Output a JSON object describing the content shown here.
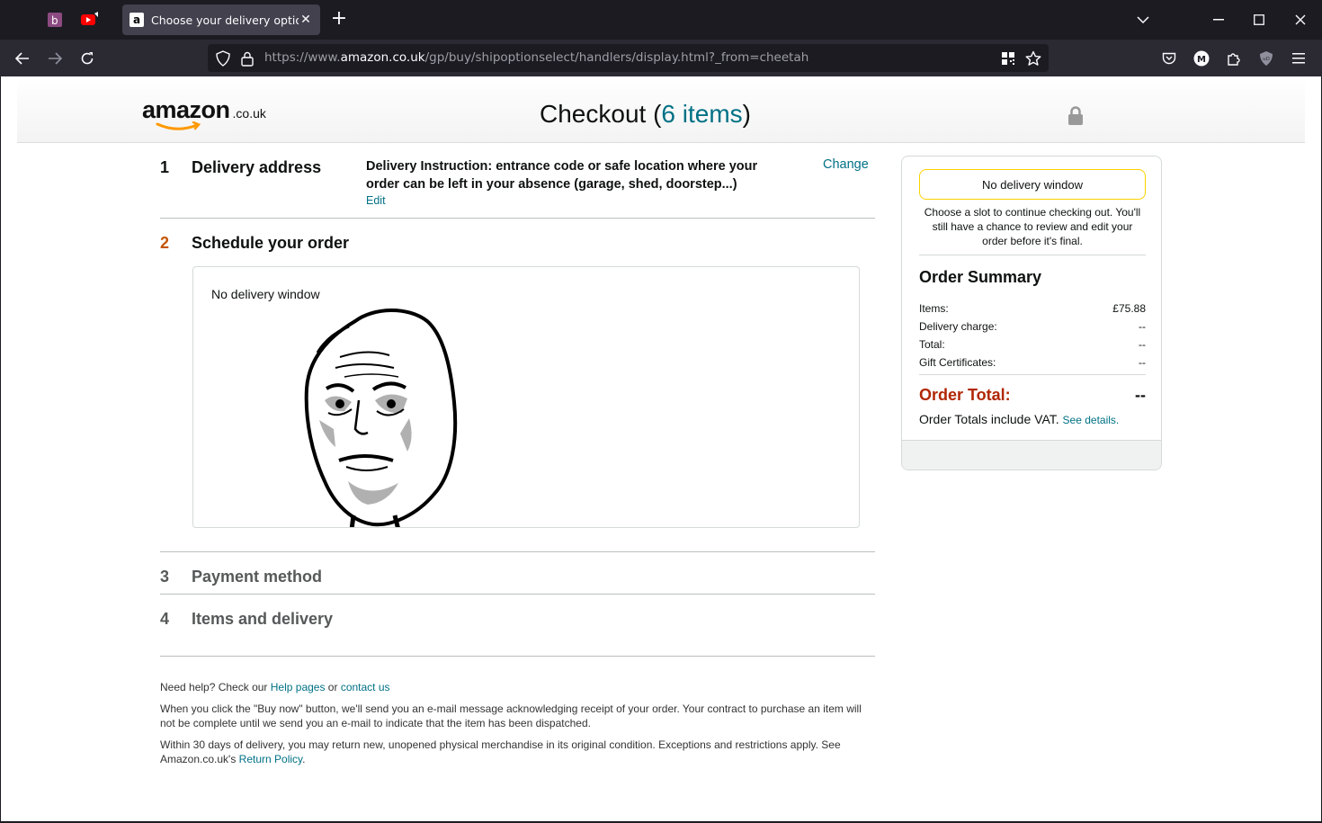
{
  "browser": {
    "tab_title": "Choose your delivery options",
    "tab_favicon": "a",
    "url_protocol": "https://www.",
    "url_host": "amazon.co.uk",
    "url_path": "/gp/buy/shipoptionselect/handlers/display.html?_from=cheetah",
    "profile_initial": "M",
    "extension_badge": "uD"
  },
  "header": {
    "logo_word": "amazon",
    "logo_tld": ".co.uk",
    "checkout_label": "Checkout",
    "items_open": "(",
    "items_count": "6 items",
    "items_close": ")"
  },
  "steps": [
    {
      "number": "1",
      "title": "Delivery address"
    },
    {
      "number": "2",
      "title": "Schedule your order"
    },
    {
      "number": "3",
      "title": "Payment method"
    },
    {
      "number": "4",
      "title": "Items and delivery"
    }
  ],
  "delivery": {
    "instruction": "Delivery Instruction: entrance code or safe location where your order can be left in your absence (garage, shed, doorstep...)",
    "edit_label": "Edit",
    "change_label": "Change"
  },
  "schedule": {
    "no_window_text": "No delivery window"
  },
  "footer": {
    "help_prefix": "Need help? Check our ",
    "help_pages": "Help pages",
    "help_or": " or ",
    "contact_us": "contact us",
    "buy_now_text": "When you click the \"Buy now\" button, we'll send you an e-mail message acknowledging receipt of your order. Your contract to purchase an item will not be complete until we send you an e-mail to indicate that the item has been dispatched.",
    "return_text": "Within 30 days of delivery, you may return new, unopened physical merchandise in its original condition. Exceptions and restrictions apply. See Amazon.co.uk's ",
    "return_policy": "Return Policy",
    "return_end": "."
  },
  "sidebar": {
    "delivery_window_button": "No delivery window",
    "note": "Choose a slot to continue checking out. You'll still have a chance to review and edit your order before it's final.",
    "summary_title": "Order Summary",
    "rows": [
      {
        "label": "Items:",
        "value": "£75.88"
      },
      {
        "label": "Delivery charge:",
        "value": "--"
      },
      {
        "label": "Total:",
        "value": "--"
      },
      {
        "label": "Gift Certificates:",
        "value": "--"
      }
    ],
    "order_total_label": "Order Total:",
    "order_total_value": "--",
    "vat_text": "Order Totals include VAT.",
    "see_details": "See details."
  },
  "colors": {
    "link": "#007185",
    "active_step": "#c45500",
    "order_total": "#b12704",
    "button_border": "#fcd200"
  }
}
